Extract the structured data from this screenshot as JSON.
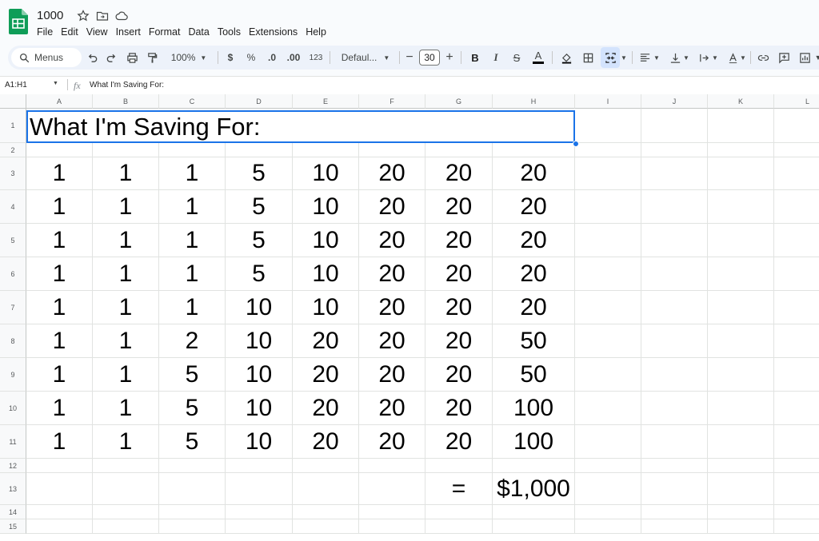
{
  "doc": {
    "title": "1000"
  },
  "menu": [
    "File",
    "Edit",
    "View",
    "Insert",
    "Format",
    "Data",
    "Tools",
    "Extensions",
    "Help"
  ],
  "toolbar": {
    "menus_label": "Menus",
    "zoom": "100%",
    "currency": "$",
    "percent": "%",
    "dec_decrease": ".0",
    "dec_increase": ".00",
    "number_format": "123",
    "font": "Defaul...",
    "font_size": "30",
    "bold": "B",
    "italic": "I",
    "strike": "S",
    "text_color": "A"
  },
  "formula_bar": {
    "name_box": "A1:H1",
    "fx": "fx",
    "content": "What I'm Saving For:"
  },
  "columns": [
    "A",
    "B",
    "C",
    "D",
    "E",
    "F",
    "G",
    "H",
    "I",
    "J",
    "K",
    "L"
  ],
  "rows": [
    "1",
    "2",
    "3",
    "4",
    "5",
    "6",
    "7",
    "8",
    "9",
    "10",
    "11",
    "12",
    "13",
    "14",
    "15"
  ],
  "sheet": {
    "title": "What I'm Saving For:",
    "values": [
      [
        "1",
        "1",
        "1",
        "5",
        "10",
        "20",
        "20",
        "20"
      ],
      [
        "1",
        "1",
        "1",
        "5",
        "10",
        "20",
        "20",
        "20"
      ],
      [
        "1",
        "1",
        "1",
        "5",
        "10",
        "20",
        "20",
        "20"
      ],
      [
        "1",
        "1",
        "1",
        "5",
        "10",
        "20",
        "20",
        "20"
      ],
      [
        "1",
        "1",
        "1",
        "10",
        "10",
        "20",
        "20",
        "20"
      ],
      [
        "1",
        "1",
        "2",
        "10",
        "20",
        "20",
        "20",
        "50"
      ],
      [
        "1",
        "1",
        "5",
        "10",
        "20",
        "20",
        "20",
        "50"
      ],
      [
        "1",
        "1",
        "5",
        "10",
        "20",
        "20",
        "20",
        "100"
      ],
      [
        "1",
        "1",
        "5",
        "10",
        "20",
        "20",
        "20",
        "100"
      ]
    ],
    "equals": "=",
    "total": "$1,000"
  }
}
